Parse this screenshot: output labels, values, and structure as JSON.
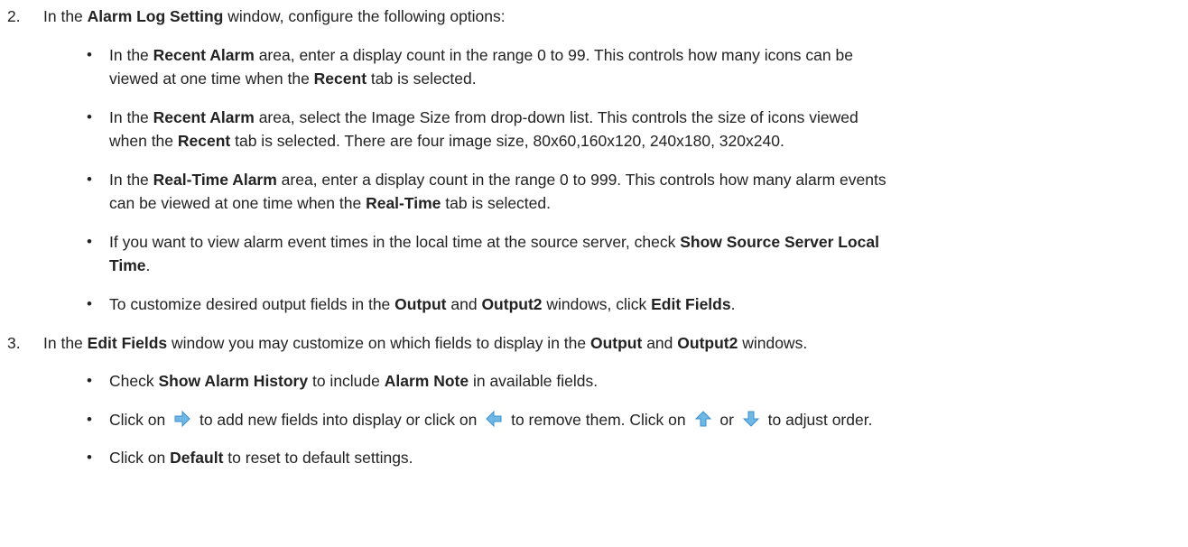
{
  "step2": {
    "number": "2.",
    "t1": "In the ",
    "b1": "Alarm Log Setting",
    "t2": " window, configure the following options:"
  },
  "step2_bullets": [
    {
      "l1": {
        "t1": "In the ",
        "b1": "Recent Alarm",
        "t2": " area, enter a display count in the range 0 to 99. This controls how many icons can be"
      },
      "l2": {
        "t1": "viewed at one time when the ",
        "b1": "Recent",
        "t2": " tab is selected."
      }
    },
    {
      "l1": {
        "t1": "In the ",
        "b1": "Recent Alarm",
        "t2": " area, select the Image Size from drop-down list. This controls the size of icons viewed"
      },
      "l2": {
        "t1": "when the ",
        "b1": "Recent",
        "t2": " tab is selected. There are four image size, 80x60,160x120, 240x180, 320x240."
      }
    },
    {
      "l1": {
        "t1": "In the ",
        "b1": "Real-Time Alarm",
        "t2": " area, enter a display count in the range 0 to 999. This controls how many alarm events"
      },
      "l2": {
        "t1": "can be viewed at one time when the ",
        "b1": "Real-Time",
        "t2": " tab is selected."
      }
    },
    {
      "l1": {
        "t1": "If you want to view alarm event times in the local time at the source server, check ",
        "b1": "Show Source Server Local"
      },
      "l2": {
        "b1": "Time",
        "t2": "."
      }
    },
    {
      "l1": {
        "t1": "To customize desired output fields in the ",
        "b1": "Output",
        "t2": " and ",
        "b2": "Output2",
        "t3": " windows, click ",
        "b3": "Edit Fields",
        "t4": "."
      }
    }
  ],
  "step3": {
    "number": "3.",
    "t1": "In the ",
    "b1": "Edit Fields",
    "t2": " window you may customize on which fields to display in the ",
    "b2": "Output",
    "t3": " and ",
    "b3": "Output2",
    "t4": " windows."
  },
  "step3_bullets": {
    "b1": {
      "t1": "Check ",
      "b1": "Show Alarm History",
      "t2": " to include ",
      "b2": "Alarm Note",
      "t3": " in available fields."
    },
    "b2": {
      "t1": "Click on ",
      "t2": " to add new fields into display or click on ",
      "t3": " to remove them.  Click on ",
      "t4": " or ",
      "t5": " to adjust order.",
      "icons": [
        "arrow-right-icon",
        "arrow-left-icon",
        "arrow-up-icon",
        "arrow-down-icon"
      ]
    },
    "b3": {
      "t1": "Click on ",
      "b1": "Default",
      "t2": " to reset to default settings."
    }
  },
  "bullet_char": "•",
  "colors": {
    "text": "#222222",
    "icon_fill": "#6fb8e6",
    "icon_stroke": "#3a8fd0"
  }
}
